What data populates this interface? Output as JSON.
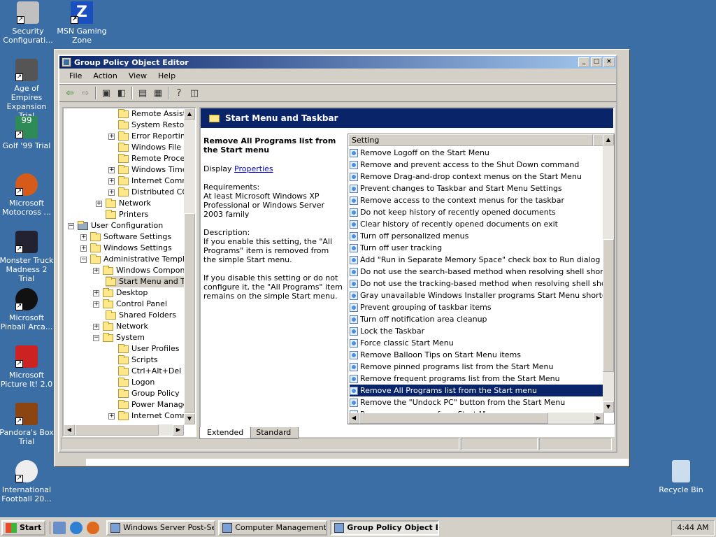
{
  "desktop": {
    "icons": [
      {
        "label": "Security Configurati..."
      },
      {
        "label": "MSN Gaming Zone"
      },
      {
        "label": "Age of Empires Expansion Trial"
      },
      {
        "label": "Golf '99 Trial"
      },
      {
        "label": "Microsoft Motocross ..."
      },
      {
        "label": "Monster Truck Madness 2 Trial"
      },
      {
        "label": "Microsoft Pinball Arca..."
      },
      {
        "label": "Microsoft Picture It! 2.0"
      },
      {
        "label": "Pandora's Box Trial"
      },
      {
        "label": "International Football 20..."
      },
      {
        "label": "Recycle Bin"
      }
    ]
  },
  "window": {
    "title": "Group Policy Object Editor",
    "controls": {
      "minimize": "_",
      "maximize": "□",
      "close": "×"
    }
  },
  "menu": {
    "file": "File",
    "action": "Action",
    "view": "View",
    "help": "Help"
  },
  "tree": {
    "items": [
      {
        "label": "Remote Assista"
      },
      {
        "label": "System Restore"
      },
      {
        "label": "Error Reporting"
      },
      {
        "label": "Windows File Pr"
      },
      {
        "label": "Remote Procedi"
      },
      {
        "label": "Windows Time S"
      },
      {
        "label": "Internet Commu"
      },
      {
        "label": "Distributed CON"
      },
      {
        "label": "Network"
      },
      {
        "label": "Printers"
      },
      {
        "label": "User Configuration"
      },
      {
        "label": "Software Settings"
      },
      {
        "label": "Windows Settings"
      },
      {
        "label": "Administrative Template"
      },
      {
        "label": "Windows Componer"
      },
      {
        "label": "Start Menu and Tas"
      },
      {
        "label": "Desktop"
      },
      {
        "label": "Control Panel"
      },
      {
        "label": "Shared Folders"
      },
      {
        "label": "Network"
      },
      {
        "label": "System"
      },
      {
        "label": "User Profiles"
      },
      {
        "label": "Scripts"
      },
      {
        "label": "Ctrl+Alt+Del Op"
      },
      {
        "label": "Logon"
      },
      {
        "label": "Group Policy"
      },
      {
        "label": "Power Manager"
      },
      {
        "label": "Internet Commu"
      }
    ]
  },
  "right": {
    "header": "Start Menu and Taskbar",
    "desc_title": "Remove All Programs list from the Start menu",
    "display_label": "Display",
    "display_link": "Properties",
    "requirements": "Requirements:\nAt least Microsoft Windows XP Professional or Windows Server 2003 family",
    "description": "Description:\nIf you enable this setting, the \"All Programs\" item is removed from the simple Start menu.",
    "description2": "If you disable this setting or do not configure it, the \"All Programs\" item remains on the simple Start menu.",
    "column": "Setting",
    "settings": [
      "Remove Logoff on the Start Menu",
      "Remove and prevent access to the Shut Down command",
      "Remove Drag-and-drop context menus on the Start Menu",
      "Prevent changes to Taskbar and Start Menu Settings",
      "Remove access to the context menus for the taskbar",
      "Do not keep history of recently opened documents",
      "Clear history of recently opened documents on exit",
      "Turn off personalized menus",
      "Turn off user tracking",
      "Add \"Run in Separate Memory Space\" check box to Run dialog box",
      "Do not use the search-based method when resolving shell shortcuts",
      "Do not use the tracking-based method when resolving shell short…",
      "Gray unavailable Windows Installer programs Start Menu shortcuts",
      "Prevent grouping of taskbar items",
      "Turn off notification area cleanup",
      "Lock the Taskbar",
      "Force classic Start Menu",
      "Remove Balloon Tips on Start Menu items",
      "Remove pinned programs list from the Start Menu",
      "Remove frequent programs list from the Start Menu",
      "Remove All Programs list from the Start menu",
      "Remove the \"Undock PC\" button from the Start Menu",
      "Remove user name from Start Menu"
    ],
    "selected_index": 20
  },
  "tabs": {
    "extended": "Extended",
    "standard": "Standard"
  },
  "taskbar": {
    "start": "Start",
    "tasks": [
      "Windows Server Post-Se...",
      "Computer Management",
      "Group Policy Object E..."
    ],
    "clock": "4:44 AM"
  }
}
